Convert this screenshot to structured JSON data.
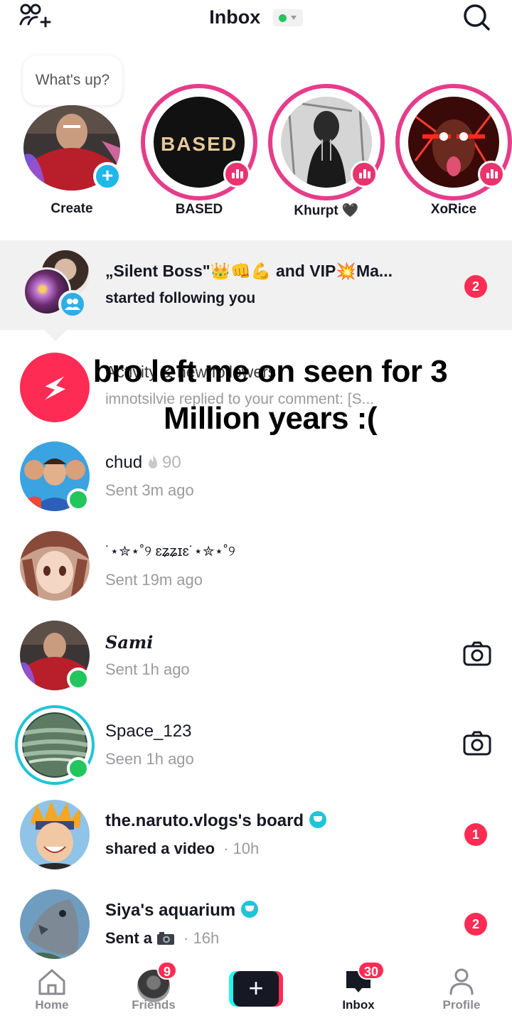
{
  "header": {
    "title": "Inbox",
    "status_color": "#22c55e",
    "icons": [
      "add-friends-icon",
      "search-icon"
    ]
  },
  "stories": {
    "create": {
      "bubble": "What's up?",
      "label": "Create"
    },
    "items": [
      {
        "name": "BASED",
        "logo_text": "BASED"
      },
      {
        "name": "Khurpt 🖤"
      },
      {
        "name": "XoRice"
      }
    ]
  },
  "follow_notice": {
    "title": "„Silent Boss\"👑👊💪 and VIP💥Ma...",
    "subtitle": "started following you",
    "badge": "2"
  },
  "activity": {
    "title": "Activity & new followers",
    "subtitle": "imnotsilvie replied to your comment: [S..."
  },
  "overlay_caption": "bro left me on seen for 3 Million years :(",
  "chats": [
    {
      "name": "chud",
      "streak": "90",
      "sub": "Sent 3m ago",
      "online": true
    },
    {
      "name": "˙⋆✮⋆˚୨ ɛʑʑɪɛ˙⋆✮⋆˚୨",
      "sub": "Sent 19m ago",
      "online": false
    },
    {
      "name": "𝑺𝒂𝒎𝒊",
      "sub": "Sent 1h ago",
      "online": true
    },
    {
      "name": "Space_123",
      "sub": "Seen 1h ago",
      "online": true
    },
    {
      "name": "the.naruto.vlogs's board",
      "sub": "shared a video",
      "time": "· 10h",
      "badge": "1"
    },
    {
      "name": "Siya's aquarium",
      "sub": "Sent a",
      "time": "· 16h",
      "badge": "2"
    }
  ],
  "nav": {
    "items": [
      {
        "label": "Home"
      },
      {
        "label": "Friends",
        "badge": "9"
      },
      {
        "label": "+"
      },
      {
        "label": "Inbox",
        "badge": "30"
      },
      {
        "label": "Profile"
      }
    ]
  },
  "colors": {
    "accent": "#fe2c55",
    "story_ring": "#e53d8a",
    "online": "#22c55e",
    "verified": "#20c4d8"
  }
}
